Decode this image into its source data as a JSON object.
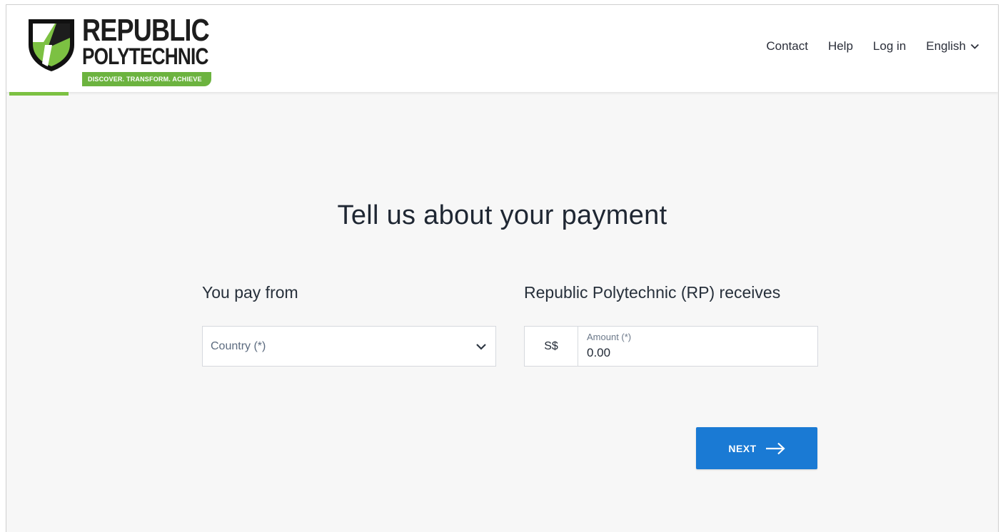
{
  "brand": {
    "name_line1": "REPUBLIC",
    "name_line2": "POLYTECHNIC",
    "tagline": "DISCOVER. TRANSFORM. ACHIEVE",
    "colors": {
      "green": "#6cb33f",
      "dark": "#1d1d1d"
    }
  },
  "nav": {
    "contact": "Contact",
    "help": "Help",
    "login": "Log in",
    "language": "English",
    "language_icon": "chevron-down-icon"
  },
  "progress": {
    "fraction": 0.06,
    "color": "#7cc142"
  },
  "main": {
    "title": "Tell us about your payment",
    "pay_from": {
      "label": "You pay from",
      "country_placeholder": "Country (*)",
      "icon": "chevron-down-icon"
    },
    "receives": {
      "label": "Republic Polytechnic (RP) receives",
      "currency": "S$",
      "amount_label": "Amount (*)",
      "amount_value": "0.00"
    },
    "next_button": {
      "label": "NEXT",
      "icon": "arrow-right-icon",
      "color": "#1a7ad4"
    }
  }
}
